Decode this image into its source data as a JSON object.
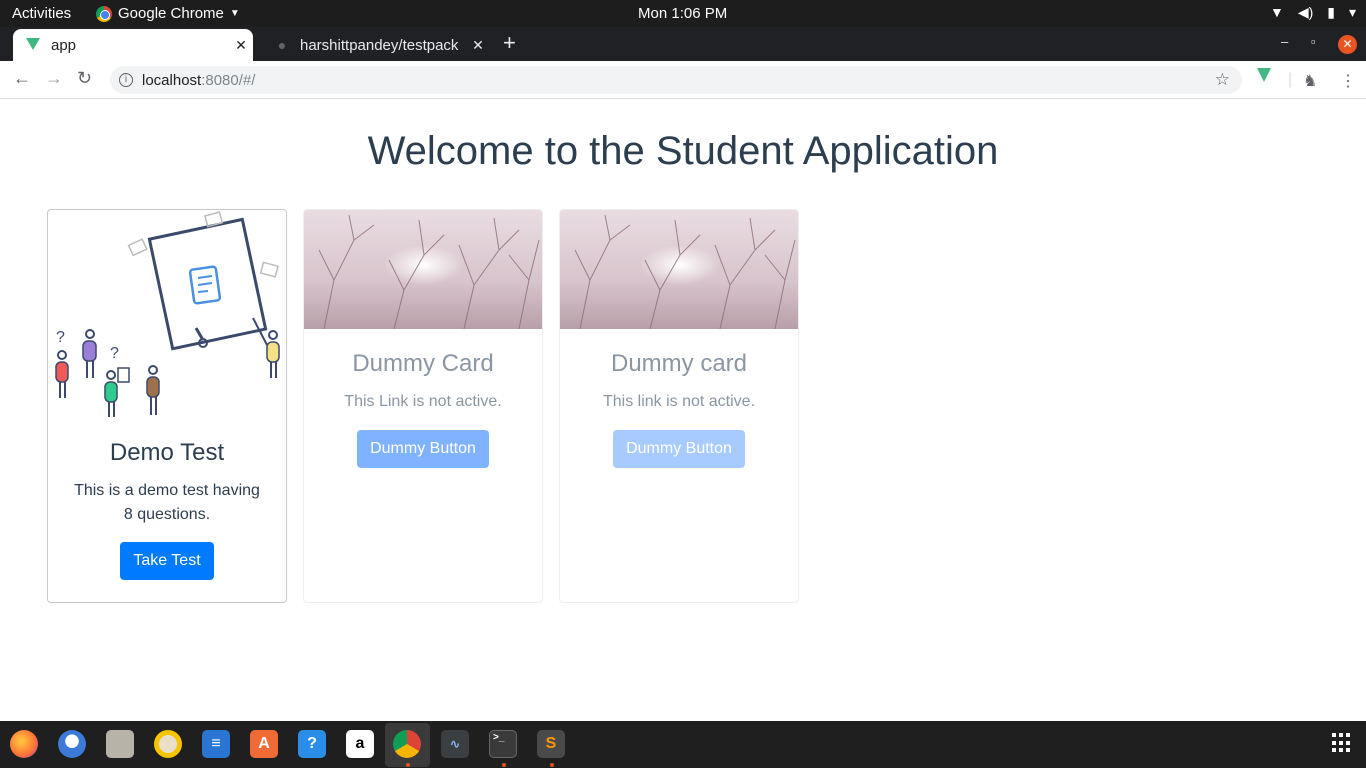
{
  "system_bar": {
    "activities": "Activities",
    "app_name": "Google Chrome",
    "clock": "Mon  1:06 PM"
  },
  "tabs": [
    {
      "title": "app",
      "active": true
    },
    {
      "title": "harshittpandey/testpack",
      "active": false
    }
  ],
  "address_bar": {
    "host": "localhost",
    "rest": ":8080/#/"
  },
  "page": {
    "heading": "Welcome to the Student Application",
    "cards": [
      {
        "title": "Demo Test",
        "text": "This is a demo test having 8 questions.",
        "button": "Take Test"
      },
      {
        "title": "Dummy Card",
        "text": "This Link is not active.",
        "button": "Dummy Button"
      },
      {
        "title": "Dummy card",
        "text": "This link is not active.",
        "button": "Dummy Button"
      }
    ]
  },
  "dock": [
    "firefox",
    "thunderbird",
    "files",
    "rhythmbox",
    "writer",
    "software",
    "help",
    "amazon",
    "chrome",
    "system-monitor",
    "terminal",
    "sublime-text"
  ],
  "colors": {
    "primary_button": "#007bff",
    "heading": "#2c3e50",
    "ubuntu_orange": "#e95420"
  }
}
